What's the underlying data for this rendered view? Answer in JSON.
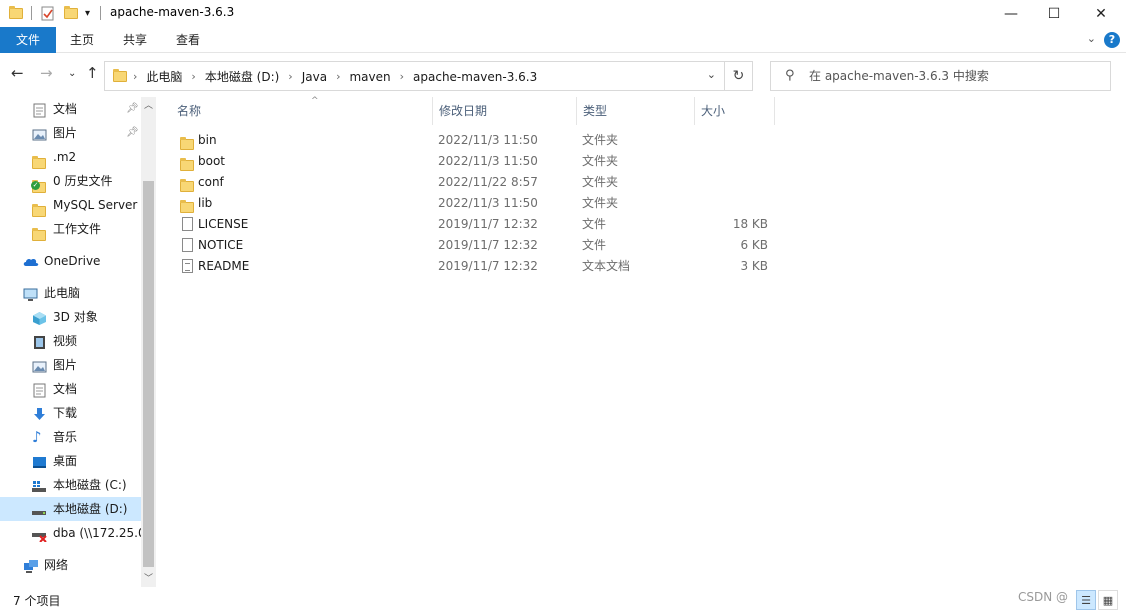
{
  "window": {
    "title": "apache-maven-3.6.3",
    "minimize_glyph": "—",
    "maximize_glyph": "☐",
    "close_glyph": "✕"
  },
  "ribbon": {
    "tabs": [
      "文件",
      "主页",
      "共享",
      "查看"
    ],
    "help": "?"
  },
  "address": {
    "crumbs": [
      "此电脑",
      "本地磁盘 (D:)",
      "Java",
      "maven",
      "apache-maven-3.6.3"
    ]
  },
  "search": {
    "placeholder": "在 apache-maven-3.6.3 中搜索"
  },
  "nav": {
    "quick": [
      {
        "label": "文档",
        "icon": "documents-icon",
        "pinned": true
      },
      {
        "label": "图片",
        "icon": "pictures-icon",
        "pinned": true
      },
      {
        "label": ".m2",
        "icon": "folder-icon"
      },
      {
        "label": "0 历史文件",
        "icon": "synced-folder-icon"
      },
      {
        "label": "MySQL Server",
        "icon": "folder-icon"
      },
      {
        "label": "工作文件",
        "icon": "folder-icon"
      }
    ],
    "onedrive": "OneDrive",
    "thispc": "此电脑",
    "thispc_items": [
      {
        "label": "3D 对象",
        "icon": "3d-objects-icon"
      },
      {
        "label": "视频",
        "icon": "videos-icon"
      },
      {
        "label": "图片",
        "icon": "pictures-icon"
      },
      {
        "label": "文档",
        "icon": "documents-icon"
      },
      {
        "label": "下载",
        "icon": "downloads-icon"
      },
      {
        "label": "音乐",
        "icon": "music-icon"
      },
      {
        "label": "桌面",
        "icon": "desktop-icon"
      },
      {
        "label": "本地磁盘 (C:)",
        "icon": "drive-c-icon"
      },
      {
        "label": "本地磁盘 (D:)",
        "icon": "drive-d-icon",
        "selected": true
      },
      {
        "label": "dba (\\\\172.25.0",
        "icon": "network-drive-disconnected-icon"
      }
    ],
    "network": "网络"
  },
  "columns": {
    "name": "名称",
    "date": "修改日期",
    "type": "类型",
    "size": "大小"
  },
  "files": [
    {
      "name": "bin",
      "date": "2022/11/3 11:50",
      "type": "文件夹",
      "size": "",
      "kind": "folder"
    },
    {
      "name": "boot",
      "date": "2022/11/3 11:50",
      "type": "文件夹",
      "size": "",
      "kind": "folder"
    },
    {
      "name": "conf",
      "date": "2022/11/22 8:57",
      "type": "文件夹",
      "size": "",
      "kind": "folder"
    },
    {
      "name": "lib",
      "date": "2022/11/3 11:50",
      "type": "文件夹",
      "size": "",
      "kind": "folder"
    },
    {
      "name": "LICENSE",
      "date": "2019/11/7 12:32",
      "type": "文件",
      "size": "18 KB",
      "kind": "file"
    },
    {
      "name": "NOTICE",
      "date": "2019/11/7 12:32",
      "type": "文件",
      "size": "6 KB",
      "kind": "file"
    },
    {
      "name": "README",
      "date": "2019/11/7 12:32",
      "type": "文本文档",
      "size": "3 KB",
      "kind": "text"
    }
  ],
  "status": {
    "count": "7 个项目",
    "watermark": "CSDN @"
  },
  "colors": {
    "accent": "#1979ca",
    "selected": "#cce8ff",
    "folder": "#f8d775"
  }
}
